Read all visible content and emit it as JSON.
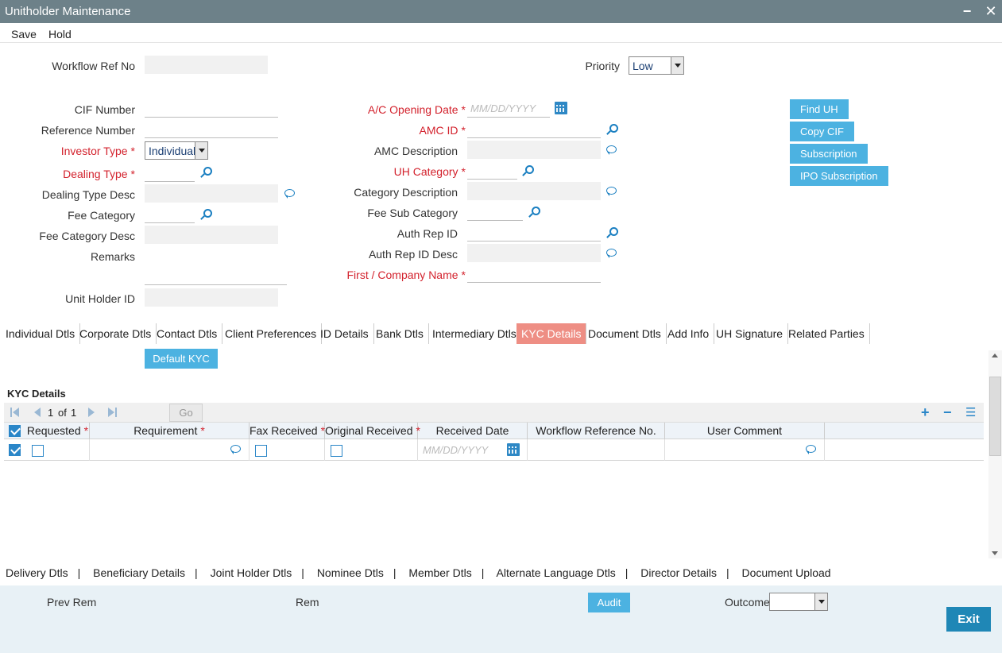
{
  "window": {
    "title": "Unitholder Maintenance",
    "minimize": "−",
    "close": "✕"
  },
  "menu": {
    "save": "Save",
    "hold": "Hold"
  },
  "header": {
    "workflow_ref_label": "Workflow Ref No",
    "workflow_ref_value": "",
    "priority_label": "Priority",
    "priority_value": "Low"
  },
  "form_left": {
    "cif_number": {
      "label": "CIF Number",
      "value": ""
    },
    "reference_number": {
      "label": "Reference Number",
      "value": ""
    },
    "investor_type": {
      "label": "Investor Type",
      "value": "Individual"
    },
    "dealing_type": {
      "label": "Dealing Type",
      "value": ""
    },
    "dealing_type_desc": {
      "label": "Dealing Type Desc",
      "value": ""
    },
    "fee_category": {
      "label": "Fee Category",
      "value": ""
    },
    "fee_category_desc": {
      "label": "Fee Category Desc",
      "value": ""
    },
    "remarks": {
      "label": "Remarks",
      "value": ""
    },
    "unit_holder_id": {
      "label": "Unit Holder ID",
      "value": ""
    }
  },
  "form_mid": {
    "ac_opening_date": {
      "label": "A/C Opening Date",
      "placeholder": "MM/DD/YYYY"
    },
    "amc_id": {
      "label": "AMC ID",
      "value": ""
    },
    "amc_description": {
      "label": "AMC Description",
      "value": ""
    },
    "uh_category": {
      "label": "UH Category",
      "value": ""
    },
    "category_description": {
      "label": "Category Description",
      "value": ""
    },
    "fee_sub_category": {
      "label": "Fee Sub Category",
      "value": ""
    },
    "auth_rep_id": {
      "label": "Auth Rep ID",
      "value": ""
    },
    "auth_rep_id_desc": {
      "label": "Auth Rep ID Desc",
      "value": ""
    },
    "first_company_name": {
      "label": "First / Company Name",
      "value": ""
    }
  },
  "side_buttons": {
    "find_uh": "Find UH",
    "copy_cif": "Copy CIF",
    "subscription": "Subscription",
    "ipo_subscription": "IPO Subscription"
  },
  "tabs": [
    "Individual Dtls",
    "Corporate Dtls",
    "Contact Dtls",
    "Client Preferences",
    "ID Details",
    "Bank Dtls",
    "Intermediary Dtls",
    "KYC Details",
    "Document Dtls",
    "Add Info",
    "UH Signature",
    "Related Parties"
  ],
  "active_tab": "KYC Details",
  "kyc": {
    "default_button": "Default KYC",
    "section_title": "KYC Details",
    "pager": {
      "page": "1",
      "of_label": "of",
      "total": "1",
      "go": "Go"
    },
    "columns": [
      "Requested",
      "Requirement",
      "Fax Received",
      "Original Received",
      "Received Date",
      "Workflow Reference No.",
      "User Comment"
    ],
    "row": {
      "requested": false,
      "requirement": "",
      "fax_received": false,
      "original_received": false,
      "received_date_placeholder": "MM/DD/YYYY",
      "workflow_ref": "",
      "user_comment": ""
    }
  },
  "bottom_links": [
    "Delivery Dtls",
    "Beneficiary Details",
    "Joint Holder Dtls",
    "Nominee Dtls",
    "Member Dtls",
    "Alternate Language Dtls",
    "Director Details",
    "Document Upload"
  ],
  "footer": {
    "prev_rem": "Prev Rem",
    "rem": "Rem",
    "audit": "Audit",
    "outcome": "Outcome",
    "outcome_value": "",
    "exit": "Exit"
  },
  "colors": {
    "titlebar": "#6d8189",
    "button": "#4cb2e1",
    "active_tab": "#ee8e84",
    "required": "#d3222d",
    "footer_bg": "#e8f1f6",
    "exit_button": "#1f87b6"
  }
}
